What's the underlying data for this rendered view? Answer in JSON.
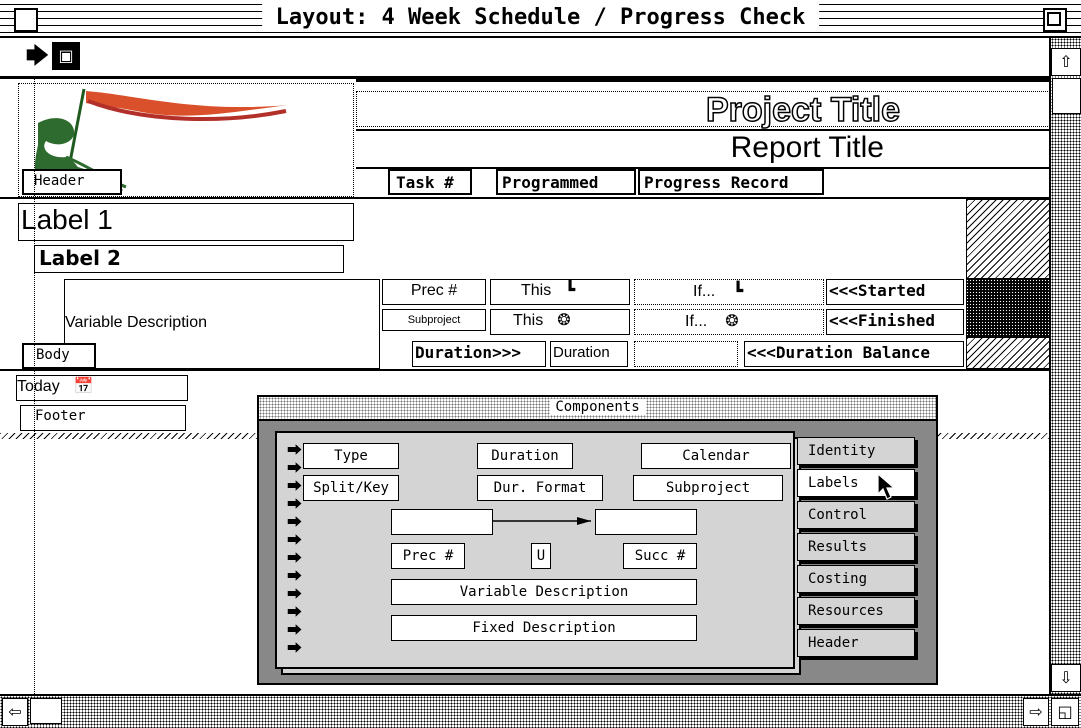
{
  "window": {
    "title": "Layout: 4 Week Schedule / Progress Check"
  },
  "toolbar": {
    "arrow_tool": "arrow-tool",
    "field_tool": "field-tool"
  },
  "layout": {
    "project_title": "Project Title",
    "report_title": "Report Title",
    "headers": {
      "task": "Task #",
      "programmed": "Programmed",
      "progress_record": "Progress Record"
    },
    "parts": {
      "header": "Header",
      "body": "Body",
      "footer": "Footer"
    },
    "label1": "Label 1",
    "label2": "Label 2",
    "variable_description": "Variable Description",
    "prec": "Prec #",
    "subproject": "Subproject",
    "this1": "This",
    "this2": "This",
    "if1": "If...",
    "if2": "If...",
    "started": "<<<Started",
    "finished": "<<<Finished",
    "duration_label": "Duration>>>",
    "duration_field": "Duration",
    "duration_balance": "<<<Duration Balance",
    "today": "Today"
  },
  "palette": {
    "title": "Components",
    "buttons": {
      "type": "Type",
      "duration": "Duration",
      "calendar": "Calendar",
      "split_key": "Split/Key",
      "dur_format": "Dur. Format",
      "subproject": "Subproject",
      "prec": "Prec #",
      "u": "U",
      "succ": "Succ #",
      "variable_description": "Variable Description",
      "fixed_description": "Fixed Description"
    },
    "tabs": [
      "Identity",
      "Labels",
      "Control",
      "Results",
      "Costing",
      "Resources",
      "Header"
    ]
  }
}
